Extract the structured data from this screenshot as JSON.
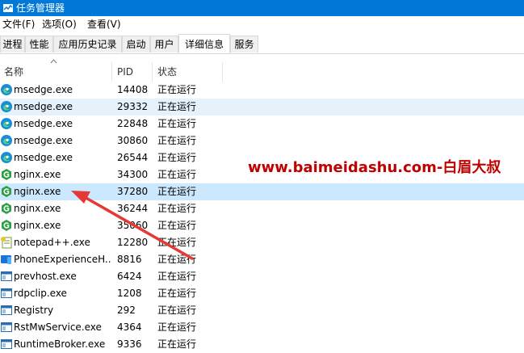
{
  "window": {
    "title": "任务管理器",
    "title_bar_color": "#0078d7"
  },
  "menu": [
    "文件(F)",
    "选项(O)",
    "查看(V)"
  ],
  "tabs": [
    "进程",
    "性能",
    "应用历史记录",
    "启动",
    "用户",
    "详细信息",
    "服务"
  ],
  "active_tab": "详细信息",
  "columns": {
    "name": "名称",
    "pid": "PID",
    "status": "状态"
  },
  "rows": [
    {
      "name": "msedge.exe",
      "pid": "14408",
      "status": "正在运行",
      "icon": "edge-icon"
    },
    {
      "name": "msedge.exe",
      "pid": "29332",
      "status": "正在运行",
      "icon": "edge-icon"
    },
    {
      "name": "msedge.exe",
      "pid": "22848",
      "status": "正在运行",
      "icon": "edge-icon"
    },
    {
      "name": "msedge.exe",
      "pid": "30860",
      "status": "正在运行",
      "icon": "edge-icon"
    },
    {
      "name": "msedge.exe",
      "pid": "26544",
      "status": "正在运行",
      "icon": "edge-icon"
    },
    {
      "name": "nginx.exe",
      "pid": "34300",
      "status": "正在运行",
      "icon": "nginx-icon"
    },
    {
      "name": "nginx.exe",
      "pid": "37280",
      "status": "正在运行",
      "icon": "nginx-icon"
    },
    {
      "name": "nginx.exe",
      "pid": "36244",
      "status": "正在运行",
      "icon": "nginx-icon"
    },
    {
      "name": "nginx.exe",
      "pid": "35060",
      "status": "正在运行",
      "icon": "nginx-icon"
    },
    {
      "name": "notepad++.exe",
      "pid": "12280",
      "status": "正在运行",
      "icon": "notepad-plus-plus-icon"
    },
    {
      "name": "PhoneExperienceH...",
      "pid": "8816",
      "status": "正在运行",
      "icon": "phone-link-icon"
    },
    {
      "name": "prevhost.exe",
      "pid": "6424",
      "status": "正在运行",
      "icon": "app-window-icon"
    },
    {
      "name": "rdpclip.exe",
      "pid": "1208",
      "status": "正在运行",
      "icon": "app-window-icon"
    },
    {
      "name": "Registry",
      "pid": "292",
      "status": "正在运行",
      "icon": "app-window-icon"
    },
    {
      "name": "RstMwService.exe",
      "pid": "4364",
      "status": "正在运行",
      "icon": "app-window-icon"
    },
    {
      "name": "RuntimeBroker.exe",
      "pid": "9336",
      "status": "正在运行",
      "icon": "app-window-icon"
    }
  ],
  "watermark": "www.baimeidashu.com-白眉大叔",
  "colors": {
    "hover_row": "#e5f1fb",
    "selected_row": "#cce8ff",
    "watermark": "#c00000",
    "arrow": "#e53935"
  }
}
